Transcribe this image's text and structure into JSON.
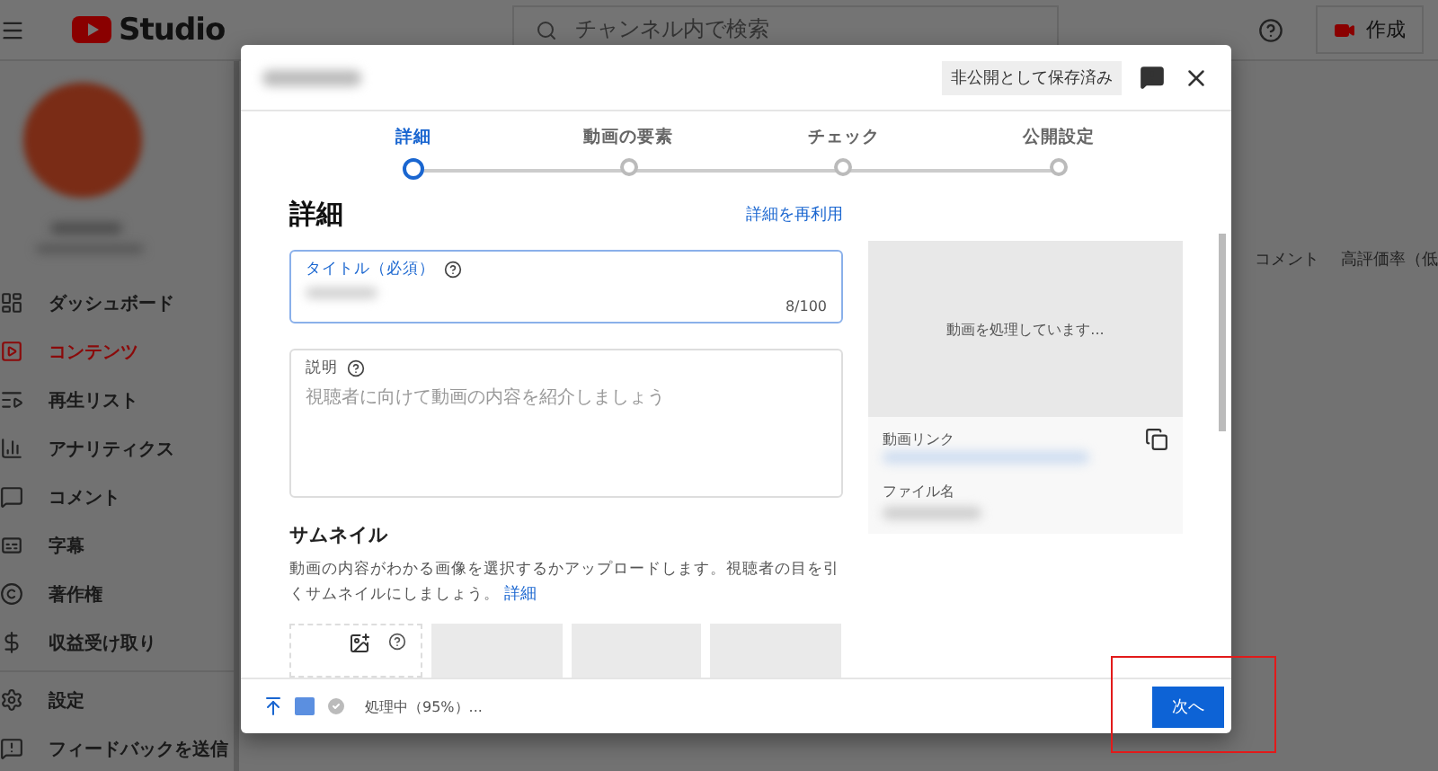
{
  "topbar": {
    "brand": "Studio",
    "search": {
      "placeholder": "チャンネル内で検索"
    },
    "create_button": "作成"
  },
  "sidebar": {
    "items": [
      {
        "label": "ダッシュボード",
        "selected": false
      },
      {
        "label": "コンテンツ",
        "selected": true
      },
      {
        "label": "再生リスト",
        "selected": false
      },
      {
        "label": "アナリティクス",
        "selected": false
      },
      {
        "label": "コメント",
        "selected": false
      },
      {
        "label": "字幕",
        "selected": false
      },
      {
        "label": "著作権",
        "selected": false
      },
      {
        "label": "収益受け取り",
        "selected": false
      }
    ],
    "bottom_items": [
      {
        "label": "設定",
        "selected": false
      },
      {
        "label": "フィードバックを送信",
        "selected": false
      }
    ]
  },
  "table": {
    "columns": [
      "コメント",
      "高評価率（低"
    ]
  },
  "dialog": {
    "status_badge": "非公開として保存済み",
    "steps": [
      {
        "label": "詳細",
        "selected": true
      },
      {
        "label": "動画の要素",
        "selected": false
      },
      {
        "label": "チェック",
        "selected": false
      },
      {
        "label": "公開設定",
        "selected": false
      }
    ],
    "heading": "詳細",
    "reuse_link": "詳細を再利用",
    "title_field": {
      "label": "タイトル（必須）",
      "counter": "8/100"
    },
    "description_field": {
      "label": "説明",
      "placeholder": "視聴者に向けて動画の内容を紹介しましょう"
    },
    "thumbnail": {
      "heading": "サムネイル",
      "text": "動画の内容がわかる画像を選択するかアップロードします。視聴者の目を引くサムネイルにしましょう。",
      "link": "詳細"
    },
    "preview": {
      "status": "動画を処理しています...",
      "link_label": "動画リンク",
      "file_label": "ファイル名"
    },
    "footer": {
      "status": "処理中（95%）...",
      "next_button": "次へ"
    }
  }
}
